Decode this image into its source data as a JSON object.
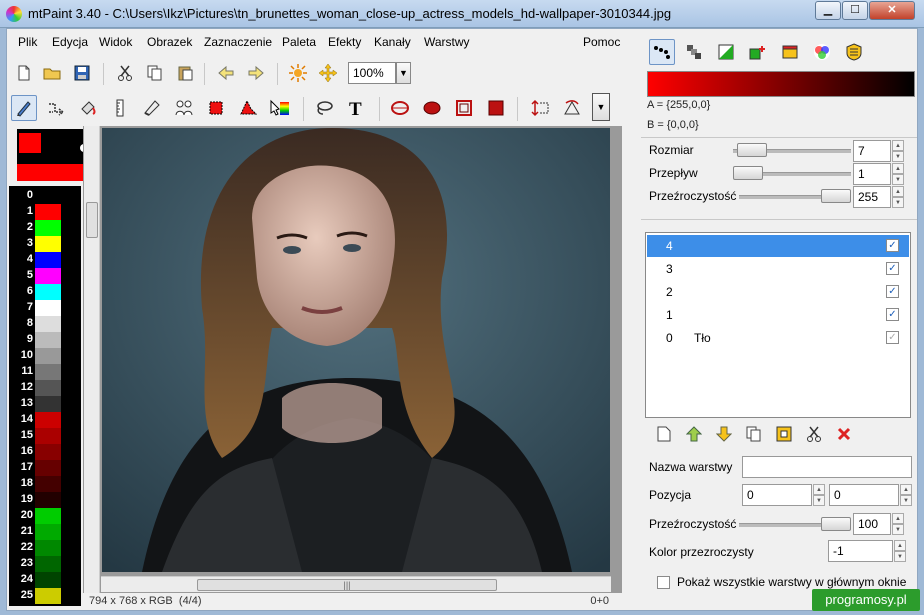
{
  "window": {
    "title": "mtPaint 3.40 - C:\\Users\\Ikz\\Pictures\\tn_brunettes_woman_close-up_actress_models_hd-wallpaper-3010344.jpg",
    "minimize": "▁",
    "maximize": "☐",
    "close": "✕"
  },
  "menu": [
    "Plik",
    "Edycja",
    "Widok",
    "Obrazek",
    "Zaznaczenie",
    "Paleta",
    "Efekty",
    "Kanały",
    "Warstwy"
  ],
  "menu_help": "Pomoc",
  "toolbar": {
    "zoom_value": "100%"
  },
  "palette": {
    "numbers": [
      "0",
      "1",
      "2",
      "3",
      "4",
      "5",
      "6",
      "7",
      "8",
      "9",
      "10",
      "11",
      "12",
      "13",
      "14",
      "15",
      "16",
      "17",
      "18",
      "19",
      "20",
      "21",
      "22",
      "23",
      "24",
      "25"
    ],
    "colors": [
      "#000000",
      "#ff0000",
      "#00ff00",
      "#ffff00",
      "#0000ff",
      "#ff00ff",
      "#00ffff",
      "#ffffff",
      "#dddddd",
      "#bbbbbb",
      "#999999",
      "#777777",
      "#555555",
      "#333333",
      "#cc0000",
      "#aa0000",
      "#880000",
      "#660000",
      "#440000",
      "#220000",
      "#00cc00",
      "#00aa00",
      "#008800",
      "#006600",
      "#004400",
      "#cccc00"
    ]
  },
  "status": {
    "image_info": "794 x 768 x RGB",
    "layer_info": "(4/4)",
    "coords": "0+0"
  },
  "colors_panel": {
    "a_label": "A = {255,0,0}",
    "b_label": "B = {0,0,0}",
    "accent_a": "#ff0000",
    "accent_b": "#000000"
  },
  "brush": {
    "size_label": "Rozmiar",
    "size_value": "7",
    "flow_label": "Przepływ",
    "flow_value": "1",
    "opacity_label": "Przeźroczystość",
    "opacity_value": "255"
  },
  "layers": [
    {
      "num": "4",
      "name": "",
      "visible": "✓"
    },
    {
      "num": "3",
      "name": "",
      "visible": "✓"
    },
    {
      "num": "2",
      "name": "",
      "visible": "✓"
    },
    {
      "num": "1",
      "name": "",
      "visible": "✓"
    },
    {
      "num": "0",
      "name": "Tło",
      "visible": "✓"
    }
  ],
  "layer_props": {
    "name_label": "Nazwa warstwy",
    "name_value": "",
    "position_label": "Pozycja",
    "pos_x": "0",
    "pos_y": "0",
    "opacity_label": "Przeźroczystość",
    "opacity_value": "100",
    "transparent_label": "Kolor przezroczysty",
    "transparent_value": "-1",
    "show_all_label": "Pokaż wszystkie warstwy w głównym oknie"
  },
  "watermark": "programosy.pl"
}
